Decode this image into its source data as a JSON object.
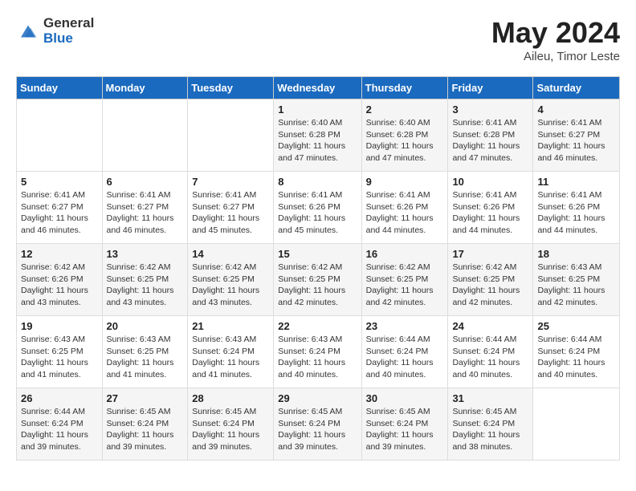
{
  "logo": {
    "general": "General",
    "blue": "Blue"
  },
  "title": {
    "month_year": "May 2024",
    "subtitle": "Aileu, Timor Leste"
  },
  "days_of_week": [
    "Sunday",
    "Monday",
    "Tuesday",
    "Wednesday",
    "Thursday",
    "Friday",
    "Saturday"
  ],
  "weeks": [
    [
      {
        "day": "",
        "sunrise": "",
        "sunset": "",
        "daylight": ""
      },
      {
        "day": "",
        "sunrise": "",
        "sunset": "",
        "daylight": ""
      },
      {
        "day": "",
        "sunrise": "",
        "sunset": "",
        "daylight": ""
      },
      {
        "day": "1",
        "sunrise": "Sunrise: 6:40 AM",
        "sunset": "Sunset: 6:28 PM",
        "daylight": "Daylight: 11 hours and 47 minutes."
      },
      {
        "day": "2",
        "sunrise": "Sunrise: 6:40 AM",
        "sunset": "Sunset: 6:28 PM",
        "daylight": "Daylight: 11 hours and 47 minutes."
      },
      {
        "day": "3",
        "sunrise": "Sunrise: 6:41 AM",
        "sunset": "Sunset: 6:28 PM",
        "daylight": "Daylight: 11 hours and 47 minutes."
      },
      {
        "day": "4",
        "sunrise": "Sunrise: 6:41 AM",
        "sunset": "Sunset: 6:27 PM",
        "daylight": "Daylight: 11 hours and 46 minutes."
      }
    ],
    [
      {
        "day": "5",
        "sunrise": "Sunrise: 6:41 AM",
        "sunset": "Sunset: 6:27 PM",
        "daylight": "Daylight: 11 hours and 46 minutes."
      },
      {
        "day": "6",
        "sunrise": "Sunrise: 6:41 AM",
        "sunset": "Sunset: 6:27 PM",
        "daylight": "Daylight: 11 hours and 46 minutes."
      },
      {
        "day": "7",
        "sunrise": "Sunrise: 6:41 AM",
        "sunset": "Sunset: 6:27 PM",
        "daylight": "Daylight: 11 hours and 45 minutes."
      },
      {
        "day": "8",
        "sunrise": "Sunrise: 6:41 AM",
        "sunset": "Sunset: 6:26 PM",
        "daylight": "Daylight: 11 hours and 45 minutes."
      },
      {
        "day": "9",
        "sunrise": "Sunrise: 6:41 AM",
        "sunset": "Sunset: 6:26 PM",
        "daylight": "Daylight: 11 hours and 44 minutes."
      },
      {
        "day": "10",
        "sunrise": "Sunrise: 6:41 AM",
        "sunset": "Sunset: 6:26 PM",
        "daylight": "Daylight: 11 hours and 44 minutes."
      },
      {
        "day": "11",
        "sunrise": "Sunrise: 6:41 AM",
        "sunset": "Sunset: 6:26 PM",
        "daylight": "Daylight: 11 hours and 44 minutes."
      }
    ],
    [
      {
        "day": "12",
        "sunrise": "Sunrise: 6:42 AM",
        "sunset": "Sunset: 6:26 PM",
        "daylight": "Daylight: 11 hours and 43 minutes."
      },
      {
        "day": "13",
        "sunrise": "Sunrise: 6:42 AM",
        "sunset": "Sunset: 6:25 PM",
        "daylight": "Daylight: 11 hours and 43 minutes."
      },
      {
        "day": "14",
        "sunrise": "Sunrise: 6:42 AM",
        "sunset": "Sunset: 6:25 PM",
        "daylight": "Daylight: 11 hours and 43 minutes."
      },
      {
        "day": "15",
        "sunrise": "Sunrise: 6:42 AM",
        "sunset": "Sunset: 6:25 PM",
        "daylight": "Daylight: 11 hours and 42 minutes."
      },
      {
        "day": "16",
        "sunrise": "Sunrise: 6:42 AM",
        "sunset": "Sunset: 6:25 PM",
        "daylight": "Daylight: 11 hours and 42 minutes."
      },
      {
        "day": "17",
        "sunrise": "Sunrise: 6:42 AM",
        "sunset": "Sunset: 6:25 PM",
        "daylight": "Daylight: 11 hours and 42 minutes."
      },
      {
        "day": "18",
        "sunrise": "Sunrise: 6:43 AM",
        "sunset": "Sunset: 6:25 PM",
        "daylight": "Daylight: 11 hours and 42 minutes."
      }
    ],
    [
      {
        "day": "19",
        "sunrise": "Sunrise: 6:43 AM",
        "sunset": "Sunset: 6:25 PM",
        "daylight": "Daylight: 11 hours and 41 minutes."
      },
      {
        "day": "20",
        "sunrise": "Sunrise: 6:43 AM",
        "sunset": "Sunset: 6:25 PM",
        "daylight": "Daylight: 11 hours and 41 minutes."
      },
      {
        "day": "21",
        "sunrise": "Sunrise: 6:43 AM",
        "sunset": "Sunset: 6:24 PM",
        "daylight": "Daylight: 11 hours and 41 minutes."
      },
      {
        "day": "22",
        "sunrise": "Sunrise: 6:43 AM",
        "sunset": "Sunset: 6:24 PM",
        "daylight": "Daylight: 11 hours and 40 minutes."
      },
      {
        "day": "23",
        "sunrise": "Sunrise: 6:44 AM",
        "sunset": "Sunset: 6:24 PM",
        "daylight": "Daylight: 11 hours and 40 minutes."
      },
      {
        "day": "24",
        "sunrise": "Sunrise: 6:44 AM",
        "sunset": "Sunset: 6:24 PM",
        "daylight": "Daylight: 11 hours and 40 minutes."
      },
      {
        "day": "25",
        "sunrise": "Sunrise: 6:44 AM",
        "sunset": "Sunset: 6:24 PM",
        "daylight": "Daylight: 11 hours and 40 minutes."
      }
    ],
    [
      {
        "day": "26",
        "sunrise": "Sunrise: 6:44 AM",
        "sunset": "Sunset: 6:24 PM",
        "daylight": "Daylight: 11 hours and 39 minutes."
      },
      {
        "day": "27",
        "sunrise": "Sunrise: 6:45 AM",
        "sunset": "Sunset: 6:24 PM",
        "daylight": "Daylight: 11 hours and 39 minutes."
      },
      {
        "day": "28",
        "sunrise": "Sunrise: 6:45 AM",
        "sunset": "Sunset: 6:24 PM",
        "daylight": "Daylight: 11 hours and 39 minutes."
      },
      {
        "day": "29",
        "sunrise": "Sunrise: 6:45 AM",
        "sunset": "Sunset: 6:24 PM",
        "daylight": "Daylight: 11 hours and 39 minutes."
      },
      {
        "day": "30",
        "sunrise": "Sunrise: 6:45 AM",
        "sunset": "Sunset: 6:24 PM",
        "daylight": "Daylight: 11 hours and 39 minutes."
      },
      {
        "day": "31",
        "sunrise": "Sunrise: 6:45 AM",
        "sunset": "Sunset: 6:24 PM",
        "daylight": "Daylight: 11 hours and 38 minutes."
      },
      {
        "day": "",
        "sunrise": "",
        "sunset": "",
        "daylight": ""
      }
    ]
  ]
}
